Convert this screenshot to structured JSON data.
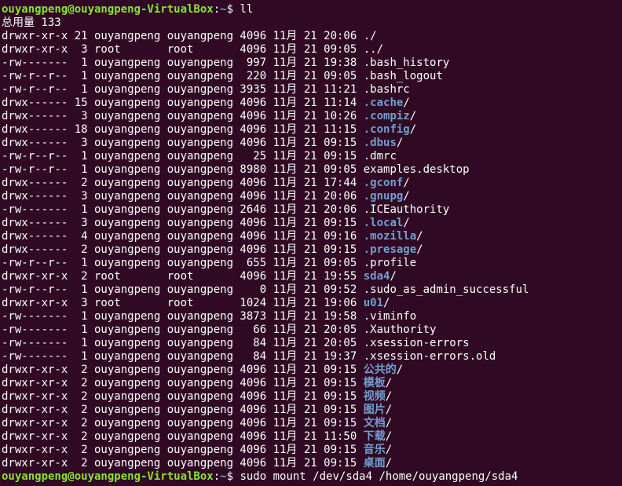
{
  "prompt": {
    "user_host": "ouyangpeng@ouyangpeng-VirtualBox",
    "sep": ":",
    "path": "~",
    "symbol": "$ "
  },
  "commands": {
    "first": "ll",
    "last": "sudo mount /dev/sda4 /home/ouyangpeng/sda4"
  },
  "total_line": "总用量 133",
  "entries": [
    {
      "meta": "drwxr-xr-x 21 ouyangpeng ouyangpeng 4096 11月 21 20:06 ",
      "name": "./",
      "is_dir": false,
      "suffix": ""
    },
    {
      "meta": "drwxr-xr-x  3 root       root       4096 11月 21 09:05 ",
      "name": "../",
      "is_dir": false,
      "suffix": ""
    },
    {
      "meta": "-rw-------  1 ouyangpeng ouyangpeng  997 11月 21 19:38 ",
      "name": ".bash_history",
      "is_dir": false,
      "suffix": ""
    },
    {
      "meta": "-rw-r--r--  1 ouyangpeng ouyangpeng  220 11月 21 09:05 ",
      "name": ".bash_logout",
      "is_dir": false,
      "suffix": ""
    },
    {
      "meta": "-rw-r--r--  1 ouyangpeng ouyangpeng 3935 11月 21 11:21 ",
      "name": ".bashrc",
      "is_dir": false,
      "suffix": ""
    },
    {
      "meta": "drwx------ 15 ouyangpeng ouyangpeng 4096 11月 21 11:14 ",
      "name": ".cache",
      "is_dir": true,
      "suffix": "/"
    },
    {
      "meta": "drwx------  3 ouyangpeng ouyangpeng 4096 11月 21 10:26 ",
      "name": ".compiz",
      "is_dir": true,
      "suffix": "/"
    },
    {
      "meta": "drwx------ 18 ouyangpeng ouyangpeng 4096 11月 21 11:15 ",
      "name": ".config",
      "is_dir": true,
      "suffix": "/"
    },
    {
      "meta": "drwx------  3 ouyangpeng ouyangpeng 4096 11月 21 09:15 ",
      "name": ".dbus",
      "is_dir": true,
      "suffix": "/"
    },
    {
      "meta": "-rw-r--r--  1 ouyangpeng ouyangpeng   25 11月 21 09:15 ",
      "name": ".dmrc",
      "is_dir": false,
      "suffix": ""
    },
    {
      "meta": "-rw-r--r--  1 ouyangpeng ouyangpeng 8980 11月 21 09:05 ",
      "name": "examples.desktop",
      "is_dir": false,
      "suffix": ""
    },
    {
      "meta": "drwx------  2 ouyangpeng ouyangpeng 4096 11月 21 17:44 ",
      "name": ".gconf",
      "is_dir": true,
      "suffix": "/"
    },
    {
      "meta": "drwx------  3 ouyangpeng ouyangpeng 4096 11月 21 20:06 ",
      "name": ".gnupg",
      "is_dir": true,
      "suffix": "/"
    },
    {
      "meta": "-rw-------  1 ouyangpeng ouyangpeng 2646 11月 21 20:06 ",
      "name": ".ICEauthority",
      "is_dir": false,
      "suffix": ""
    },
    {
      "meta": "drwx------  3 ouyangpeng ouyangpeng 4096 11月 21 09:15 ",
      "name": ".local",
      "is_dir": true,
      "suffix": "/"
    },
    {
      "meta": "drwx------  4 ouyangpeng ouyangpeng 4096 11月 21 09:16 ",
      "name": ".mozilla",
      "is_dir": true,
      "suffix": "/"
    },
    {
      "meta": "drwx------  2 ouyangpeng ouyangpeng 4096 11月 21 09:15 ",
      "name": ".presage",
      "is_dir": true,
      "suffix": "/"
    },
    {
      "meta": "-rw-r--r--  1 ouyangpeng ouyangpeng  655 11月 21 09:05 ",
      "name": ".profile",
      "is_dir": false,
      "suffix": ""
    },
    {
      "meta": "drwxr-xr-x  2 root       root       4096 11月 21 19:55 ",
      "name": "sda4",
      "is_dir": true,
      "suffix": "/"
    },
    {
      "meta": "-rw-r--r--  1 ouyangpeng ouyangpeng    0 11月 21 09:52 ",
      "name": ".sudo_as_admin_successful",
      "is_dir": false,
      "suffix": ""
    },
    {
      "meta": "drwxr-xr-x  3 root       root       1024 11月 21 19:06 ",
      "name": "u01",
      "is_dir": true,
      "suffix": "/"
    },
    {
      "meta": "-rw-------  1 ouyangpeng ouyangpeng 3873 11月 21 19:58 ",
      "name": ".viminfo",
      "is_dir": false,
      "suffix": ""
    },
    {
      "meta": "-rw-------  1 ouyangpeng ouyangpeng   66 11月 21 20:05 ",
      "name": ".Xauthority",
      "is_dir": false,
      "suffix": ""
    },
    {
      "meta": "-rw-------  1 ouyangpeng ouyangpeng   84 11月 21 20:05 ",
      "name": ".xsession-errors",
      "is_dir": false,
      "suffix": ""
    },
    {
      "meta": "-rw-------  1 ouyangpeng ouyangpeng   84 11月 21 19:37 ",
      "name": ".xsession-errors.old",
      "is_dir": false,
      "suffix": ""
    },
    {
      "meta": "drwxr-xr-x  2 ouyangpeng ouyangpeng 4096 11月 21 09:15 ",
      "name": "公共的",
      "is_dir": true,
      "suffix": "/"
    },
    {
      "meta": "drwxr-xr-x  2 ouyangpeng ouyangpeng 4096 11月 21 09:15 ",
      "name": "模板",
      "is_dir": true,
      "suffix": "/"
    },
    {
      "meta": "drwxr-xr-x  2 ouyangpeng ouyangpeng 4096 11月 21 09:15 ",
      "name": "视频",
      "is_dir": true,
      "suffix": "/"
    },
    {
      "meta": "drwxr-xr-x  2 ouyangpeng ouyangpeng 4096 11月 21 09:15 ",
      "name": "图片",
      "is_dir": true,
      "suffix": "/"
    },
    {
      "meta": "drwxr-xr-x  2 ouyangpeng ouyangpeng 4096 11月 21 09:15 ",
      "name": "文档",
      "is_dir": true,
      "suffix": "/"
    },
    {
      "meta": "drwxr-xr-x  2 ouyangpeng ouyangpeng 4096 11月 21 11:50 ",
      "name": "下载",
      "is_dir": true,
      "suffix": "/"
    },
    {
      "meta": "drwxr-xr-x  2 ouyangpeng ouyangpeng 4096 11月 21 09:15 ",
      "name": "音乐",
      "is_dir": true,
      "suffix": "/"
    },
    {
      "meta": "drwxr-xr-x  2 ouyangpeng ouyangpeng 4096 11月 21 09:15 ",
      "name": "桌面",
      "is_dir": true,
      "suffix": "/"
    }
  ],
  "colors": {
    "background": "#300a24",
    "prompt_user": "#8ae234",
    "prompt_path": "#729fcf",
    "directory": "#729fcf",
    "text": "#ffffff"
  }
}
